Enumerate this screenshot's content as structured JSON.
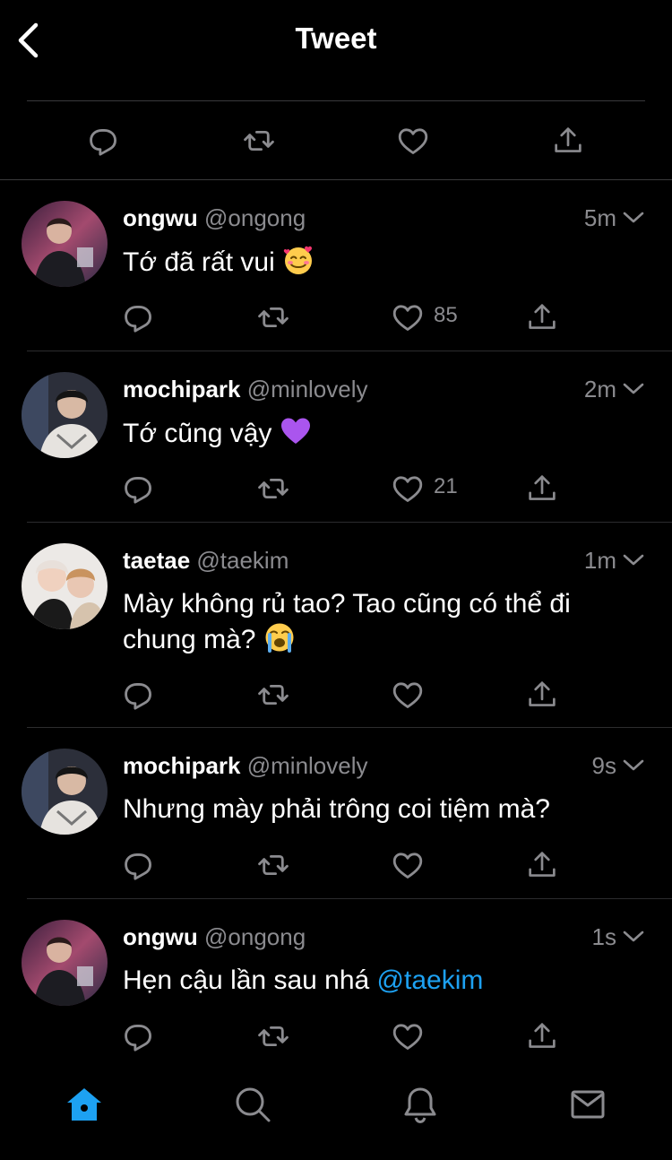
{
  "header": {
    "title": "Tweet"
  },
  "colors": {
    "accent": "#1da1f2",
    "muted": "#8b8b8f",
    "background": "#000000"
  },
  "tweets": [
    {
      "name": "ongwu",
      "handle": "@ongong",
      "time": "5m",
      "text": "Tớ đã rất vui",
      "emoji": "smiling-face-with-hearts",
      "likes": "85"
    },
    {
      "name": "mochipark",
      "handle": "@minlovely",
      "time": "2m",
      "text": "Tớ cũng vậy",
      "emoji": "purple-heart",
      "likes": "21"
    },
    {
      "name": "taetae",
      "handle": "@taekim",
      "time": "1m",
      "text_line1": "Mày không rủ tao? Tao cũng có thể đi",
      "text_line2": "chung mà?",
      "emoji": "loudly-crying-face",
      "likes": ""
    },
    {
      "name": "mochipark",
      "handle": "@minlovely",
      "time": "9s",
      "text": "Nhưng mày phải trông coi tiệm mà?",
      "likes": ""
    },
    {
      "name": "ongwu",
      "handle": "@ongong",
      "time": "1s",
      "text": "Hẹn cậu lần sau nhá",
      "mention": "@taekim",
      "likes": ""
    }
  ],
  "tabbar": {
    "items": [
      "home-icon",
      "search-icon",
      "notifications-icon",
      "messages-icon"
    ],
    "active": "home-icon"
  }
}
